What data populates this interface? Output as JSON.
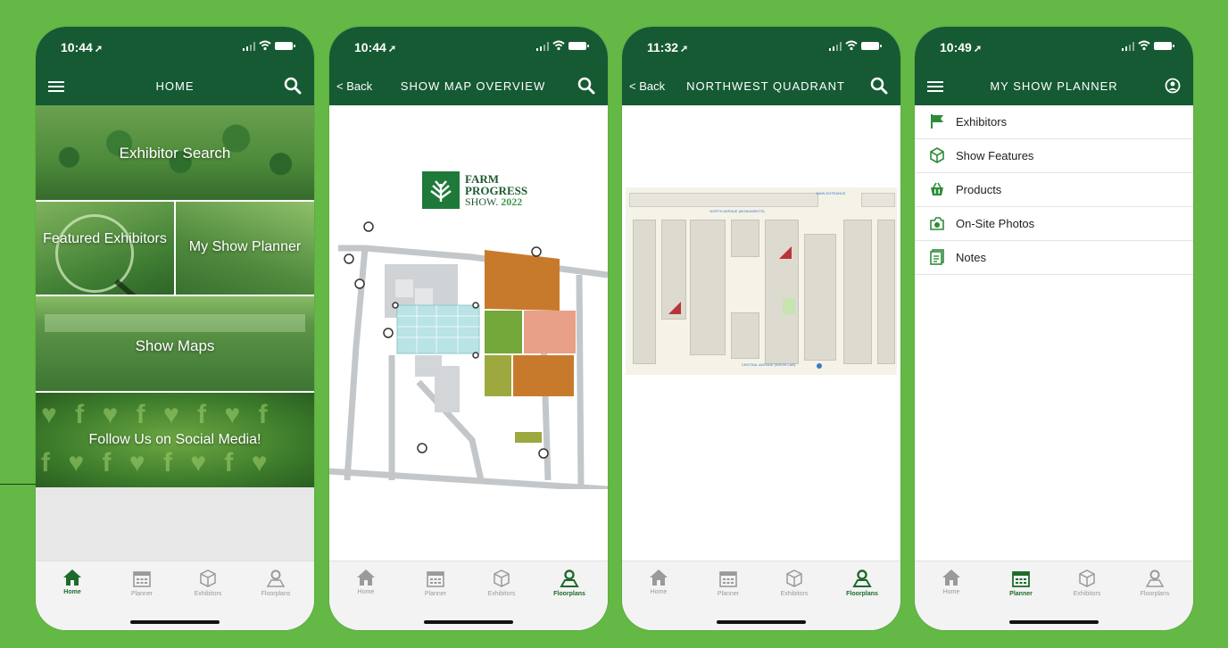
{
  "colors": {
    "background": "#64b845",
    "header": "#155a33",
    "accent": "#1d6b2b",
    "road": "#bfc3c6",
    "parking": "#cfd3d6",
    "lot": "#b9e3e4",
    "orange": "#c87a2c",
    "green": "#74a83b",
    "salmon": "#e8a088"
  },
  "phones": [
    {
      "time": "10:44",
      "title": "HOME",
      "tiles": {
        "exhibitor_search": "Exhibitor Search",
        "featured_exhibitors": "Featured Exhibitors",
        "my_show_planner": "My Show Planner",
        "show_maps": "Show Maps",
        "social": "Follow Us on Social Media!"
      },
      "active_tab": "home"
    },
    {
      "time": "10:44",
      "back": "< Back",
      "title": "SHOW MAP OVERVIEW",
      "logo": {
        "line1": "FARM",
        "line2": "PROGRESS",
        "line3": "SHOW.",
        "year": "2022"
      },
      "active_tab": "floorplans"
    },
    {
      "time": "11:32",
      "back": "< Back",
      "title": "NORTHWEST QUADRANT",
      "map_labels": {
        "main_entrance": "MAIN ENTRANCE",
        "north_avenue": "NORTH AVENUE (MONUMENTS)",
        "central_avenue": "CENTRAL AVENUE (SHOW LAB)"
      },
      "active_tab": "floorplans"
    },
    {
      "time": "10:49",
      "title": "MY SHOW PLANNER",
      "list": [
        {
          "label": "Exhibitors",
          "icon": "flag-icon"
        },
        {
          "label": "Show Features",
          "icon": "cube-icon"
        },
        {
          "label": "Products",
          "icon": "basket-icon"
        },
        {
          "label": "On-Site Photos",
          "icon": "camera-icon"
        },
        {
          "label": "Notes",
          "icon": "notes-icon"
        }
      ],
      "active_tab": "planner"
    }
  ],
  "tabs": {
    "home": "Home",
    "planner": "Planner",
    "exhibitors": "Exhibitors",
    "floorplans": "Floorplans"
  }
}
